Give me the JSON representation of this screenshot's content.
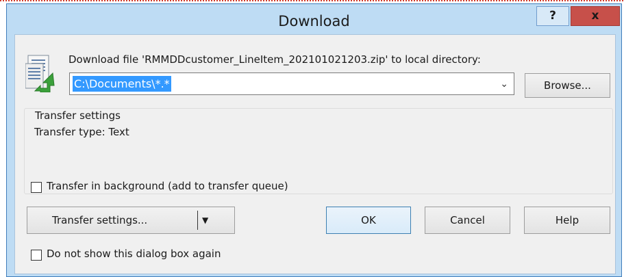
{
  "window": {
    "title": "Download"
  },
  "titlebar": {
    "help_label": "?",
    "close_label": "x"
  },
  "prompt_text": "Download file 'RMMDDcustomer_LineItem_202101021203.zip' to local directory:",
  "path_field": {
    "value": "C:\\Documents\\*.*"
  },
  "buttons": {
    "browse": "Browse...",
    "transfer_settings": "Transfer settings...",
    "ok": "OK",
    "cancel": "Cancel",
    "help": "Help"
  },
  "transfer_group": {
    "title": "Transfer settings",
    "type_text": "Transfer type: Text"
  },
  "checkboxes": {
    "background": {
      "label": "Transfer in background (add to transfer queue)",
      "checked": false
    },
    "dont_show": {
      "label": "Do not show this dialog box again",
      "checked": false
    }
  },
  "colors": {
    "titlebar": "#bedcf4",
    "close": "#c7504a",
    "selection": "#3399ff",
    "dialog": "#f0f0f0"
  }
}
